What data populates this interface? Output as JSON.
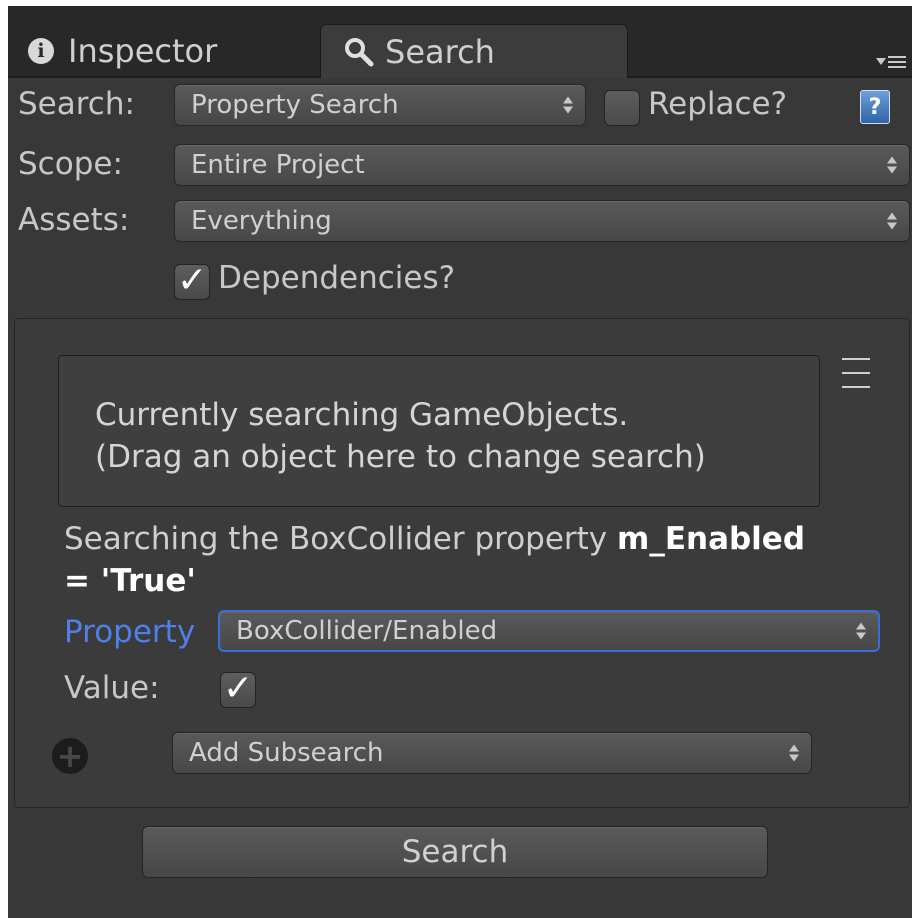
{
  "tabs": [
    {
      "label": "Inspector",
      "icon": "info-icon"
    },
    {
      "label": "Search",
      "icon": "magnifier-icon",
      "active": true
    }
  ],
  "tab_menu_icon": "tab-options-icon",
  "search_row": {
    "label": "Search:",
    "dropdown_value": "Property Search",
    "replace_label": "Replace?",
    "replace_checked": false,
    "help_icon": "help-book-icon"
  },
  "scope_row": {
    "label": "Scope:",
    "dropdown_value": "Entire Project"
  },
  "assets_row": {
    "label": "Assets:",
    "dropdown_value": "Everything"
  },
  "dependencies": {
    "label": "Dependencies?",
    "checked": true
  },
  "dropzone": {
    "line1": "Currently searching GameObjects.",
    "line2": "(Drag an object here to change search)"
  },
  "description": {
    "prefix": "Searching the BoxCollider property ",
    "property_name": "m_Enabled",
    "line2": "= 'True'"
  },
  "property_row": {
    "label": "Property",
    "dropdown_value": "BoxCollider/Enabled",
    "label_color": "#4f7fe8"
  },
  "value_row": {
    "label": "Value:",
    "checked": true
  },
  "subsearch": {
    "dropdown_value": "Add Subsearch",
    "icon": "plus-circle-icon"
  },
  "search_button": {
    "label": "Search"
  },
  "colors": {
    "background": "#383838",
    "tabbar": "#282828",
    "focus_border": "#3a6fd8"
  }
}
